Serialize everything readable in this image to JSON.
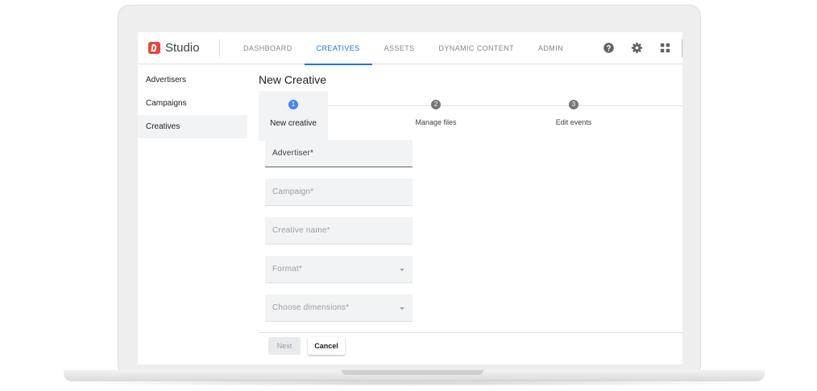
{
  "app": {
    "name": "Studio"
  },
  "nav": {
    "tabs": [
      {
        "label": "DASHBOARD"
      },
      {
        "label": "CREATIVES",
        "active": true
      },
      {
        "label": "ASSETS"
      },
      {
        "label": "DYNAMIC CONTENT"
      },
      {
        "label": "ADMIN"
      }
    ],
    "icons": [
      "help-icon",
      "gear-icon",
      "apps-grid-icon"
    ]
  },
  "sidebar": {
    "items": [
      {
        "label": "Advertisers"
      },
      {
        "label": "Campaigns"
      },
      {
        "label": "Creatives",
        "active": true
      }
    ]
  },
  "page": {
    "title": "New Creative"
  },
  "stepper": {
    "steps": [
      {
        "number": "1",
        "label": "New creative",
        "active": true
      },
      {
        "number": "2",
        "label": "Manage files"
      },
      {
        "number": "3",
        "label": "Edit events"
      }
    ]
  },
  "form": {
    "fields": [
      {
        "label": "Advertiser*"
      },
      {
        "label": "Campaign*"
      },
      {
        "label": "Creative name*"
      },
      {
        "label": "Format*"
      },
      {
        "label": "Choose dimensions*"
      }
    ],
    "next_label": "Next",
    "cancel_label": "Cancel"
  },
  "colors": {
    "accent": "#1a73e8",
    "step_active": "#4285f4",
    "logo": "#e8453c"
  }
}
